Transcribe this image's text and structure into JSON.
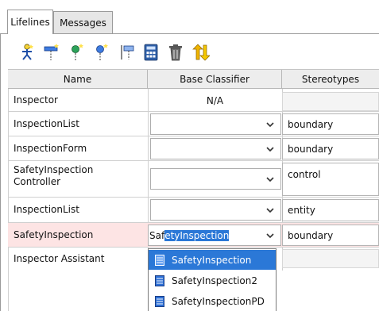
{
  "tabs": [
    {
      "label": "Lifelines",
      "active": true
    },
    {
      "label": "Messages",
      "active": false
    }
  ],
  "toolbar": {
    "icons": [
      "add-actor-lifeline-icon",
      "add-boundary-lifeline-icon",
      "add-control-lifeline-icon",
      "add-entity-lifeline-icon",
      "add-lifeline-icon",
      "calculator-icon",
      "delete-icon",
      "sort-icon"
    ]
  },
  "table": {
    "columns": [
      "Name",
      "Base Classifier",
      "Stereotypes"
    ],
    "rows": [
      {
        "name": "Inspector",
        "classifier": "N/A",
        "stereotype": ""
      },
      {
        "name": "InspectionList",
        "classifier": "",
        "stereotype": "boundary"
      },
      {
        "name": "InspectionForm",
        "classifier": "",
        "stereotype": "boundary"
      },
      {
        "name": "SafetyInspection\nController",
        "classifier": "",
        "stereotype": "control"
      },
      {
        "name": "InspectionList",
        "classifier": "",
        "stereotype": "entity"
      },
      {
        "name": "SafetyInspection",
        "classifier_prefix": "Saf",
        "classifier_selected": "etyInspection",
        "stereotype": "boundary"
      },
      {
        "name": "Inspector Assistant",
        "classifier": "",
        "stereotype": ""
      }
    ]
  },
  "dropdown": {
    "items": [
      {
        "label": "SafetyInspection",
        "selected": true
      },
      {
        "label": "SafetyInspection2",
        "selected": false
      },
      {
        "label": "SafetyInspectionPD",
        "selected": false
      }
    ]
  },
  "colors": {
    "selected_row": "#fde4e4",
    "highlight": "#2b78d7"
  }
}
